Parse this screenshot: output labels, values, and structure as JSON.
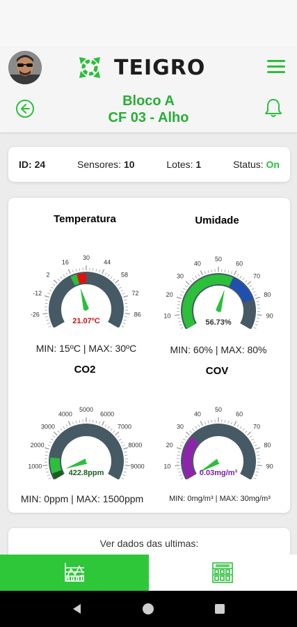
{
  "header": {
    "logo_text": "TEIGRO",
    "title_line1": "Bloco A",
    "title_line2": "CF 03 - Alho"
  },
  "info": {
    "id_label": "ID:",
    "id_value": "24",
    "sensors_label": "Sensores:",
    "sensors_value": "10",
    "lots_label": "Lotes:",
    "lots_value": "1",
    "status_label": "Status:",
    "status_value": "On"
  },
  "gauges": [
    {
      "title": "Temperatura",
      "title_color": "#cc1111",
      "value": 21.07,
      "value_label": "21.07ºC",
      "value_color": "#cc1111",
      "min": -40,
      "max": 100,
      "ticks": [
        "-40",
        "-26",
        "-12",
        "2",
        "16",
        "30",
        "44",
        "58",
        "72",
        "86",
        "100"
      ],
      "green_range": [
        15,
        30
      ],
      "accent_range": [
        21.07,
        30
      ],
      "accent_color": "#e01010",
      "minmax": "MIN: 15ºC | MAX: 30ºC"
    },
    {
      "title": "Umidade",
      "title_color": "#1b3fa0",
      "value": 56.73,
      "value_label": "56.73%",
      "value_color": "#333333",
      "min": 0,
      "max": 100,
      "ticks": [
        "0",
        "10",
        "20",
        "30",
        "40",
        "50",
        "60",
        "70",
        "80",
        "90",
        "100"
      ],
      "green_range": [
        0,
        60
      ],
      "accent_range": [
        60,
        80
      ],
      "accent_color": "#1f4fb0",
      "minmax": "MIN: 60% | MAX: 80%"
    },
    {
      "title": "CO2",
      "title_color": "#1b5e20",
      "value": 422.8,
      "value_label": "422.8ppm",
      "value_color": "#1b5e20",
      "min": 0,
      "max": 10000,
      "ticks": [
        "0",
        "1000",
        "2000",
        "3000",
        "4000",
        "5000",
        "6000",
        "7000",
        "8000",
        "9000",
        "10000"
      ],
      "green_range": [
        0,
        1500
      ],
      "accent_range": [
        0,
        422.8
      ],
      "accent_color": "#1b5e20",
      "minmax": "MIN: 0ppm | MAX: 1500ppm"
    },
    {
      "title": "COV",
      "title_color": "#7b1fa2",
      "value": 0.03,
      "value_label": "0.03mg/m³",
      "value_color": "#7b1fa2",
      "min": 0,
      "max": 100,
      "ticks": [
        "0",
        "10",
        "20",
        "30",
        "40",
        "50",
        "60",
        "70",
        "80",
        "90",
        "100"
      ],
      "green_range": [
        0,
        30
      ],
      "accent_range": [
        0,
        30
      ],
      "accent_color": "#8e24aa",
      "minmax": "MIN: 0mg/m³ | MAX: 30mg/m³"
    }
  ],
  "history": {
    "label": "Ver dados das ultimas:"
  },
  "colors": {
    "brand_green": "#2bbf3a",
    "gauge_dark": "#455a64"
  },
  "icons": {
    "back": "arrow-left-circle-icon",
    "bell": "bell-icon",
    "menu": "hamburger-menu-icon",
    "tab1": "chart-icon",
    "tab2": "warehouse-icon"
  }
}
